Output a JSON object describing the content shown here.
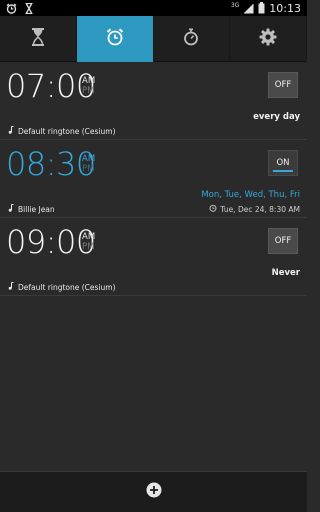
{
  "status_bar": {
    "time": "10:13",
    "network_label": "3G",
    "icons": [
      "alarm-icon",
      "hourglass-icon",
      "signal-icon",
      "battery-icon"
    ]
  },
  "tabs": [
    {
      "name": "timer",
      "icon": "hourglass-icon",
      "active": false
    },
    {
      "name": "alarm",
      "icon": "alarm-clock-icon",
      "active": true
    },
    {
      "name": "stopwatch",
      "icon": "stopwatch-icon",
      "active": false
    },
    {
      "name": "settings",
      "icon": "gear-icon",
      "active": false
    }
  ],
  "accent_color": "#33a9dc",
  "alarms": [
    {
      "time": "07:00",
      "am": "AM",
      "pm": "PM",
      "toggle": "OFF",
      "enabled": false,
      "repeat": "every day",
      "ringtone": "Default ringtone (Cesium)"
    },
    {
      "time": "08:30",
      "am": "AM",
      "pm": "PM",
      "toggle": "ON",
      "enabled": true,
      "repeat": "Mon, Tue, Wed, Thu, Fri",
      "ringtone": "Billie Jean",
      "next": "Tue, Dec 24, 8:30 AM"
    },
    {
      "time": "09:00",
      "am": "AM",
      "pm": "PM",
      "toggle": "OFF",
      "enabled": false,
      "repeat": "Never",
      "ringtone": "Default ringtone (Cesium)"
    }
  ],
  "bottom_bar": {
    "add_icon": "add-circle-icon"
  }
}
